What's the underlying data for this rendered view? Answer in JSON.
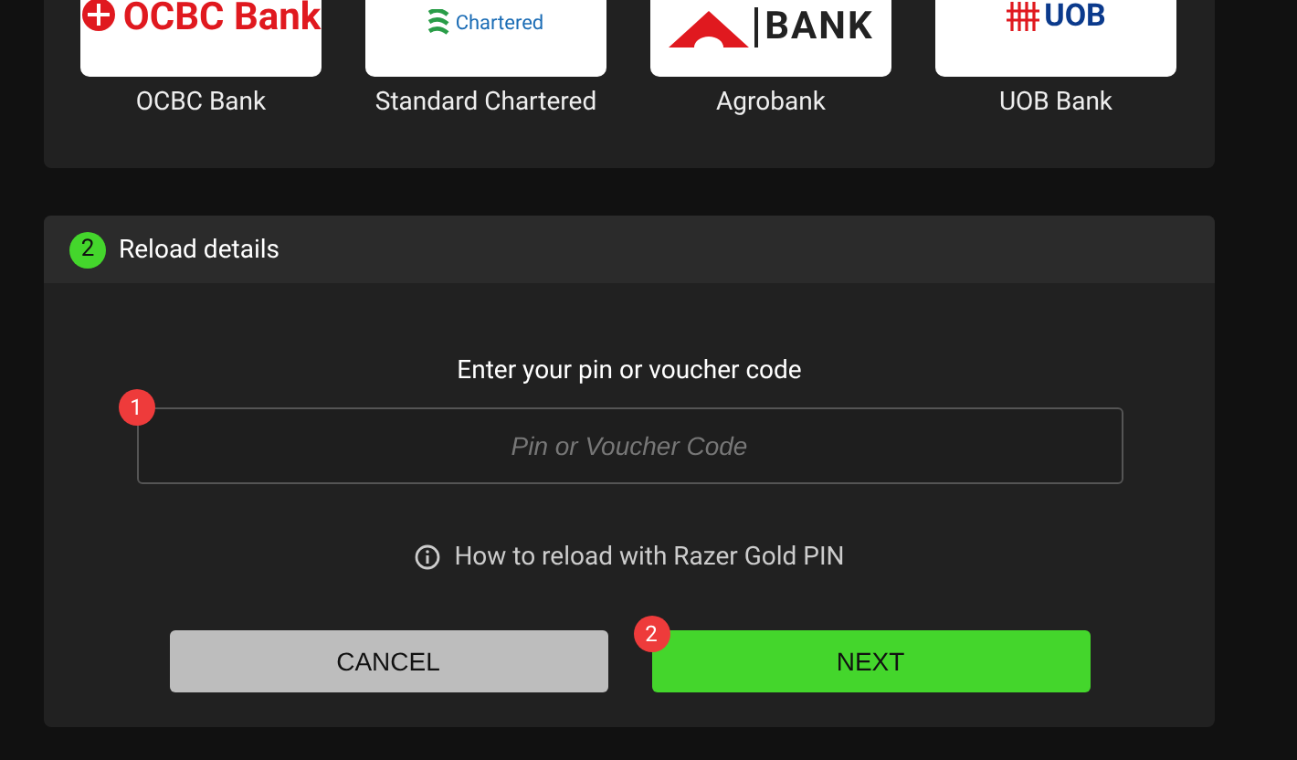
{
  "banks": [
    {
      "name": "OCBC Bank",
      "logo_text": "OCBC Bank",
      "kind": "ocbc",
      "selected": false
    },
    {
      "name": "Standard Chartered",
      "logo_text": "Chartered",
      "kind": "sc",
      "selected": false
    },
    {
      "name": "Agrobank",
      "logo_text": "BANK",
      "kind": "agro",
      "selected": false
    },
    {
      "name": "UOB Bank",
      "logo_text": "UOB",
      "kind": "uob",
      "selected": false
    }
  ],
  "step": {
    "number": "2",
    "title": "Reload details"
  },
  "pin": {
    "label": "Enter your pin or voucher code",
    "placeholder": "Pin or Voucher Code",
    "badge": "1"
  },
  "help_link": "How to reload with Razer Gold PIN",
  "buttons": [
    {
      "label": "CANCEL",
      "kind": "secondary"
    },
    {
      "label": "NEXT",
      "kind": "primary",
      "badge": "2"
    }
  ]
}
